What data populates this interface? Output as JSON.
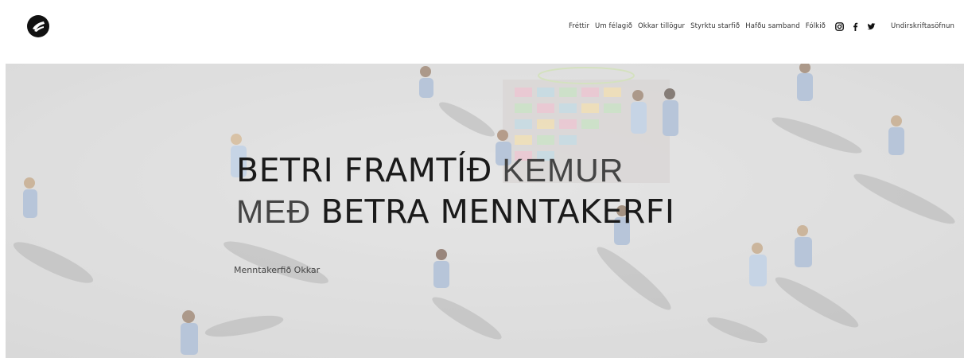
{
  "nav": {
    "items": [
      "Fréttir",
      "Um félagið",
      "Okkar tillögur",
      "Styrktu starfið",
      "Hafðu samband",
      "Fólkið"
    ],
    "social": [
      "instagram-icon",
      "facebook-icon",
      "twitter-icon"
    ],
    "petition": "Undirskriftasöfnun"
  },
  "hero": {
    "line1_bold": "BETRI FRAMTÍÐ",
    "line1_thin": " KEMUR",
    "line2_thin": "MEÐ ",
    "line2_bold": "BETRA MENNTAKERFI",
    "tagline": "Menntakerfið Okkar"
  },
  "colors": {
    "text": "#1a1a1a",
    "nav_text": "#333333",
    "hero_bg": "#d6d6d6"
  }
}
